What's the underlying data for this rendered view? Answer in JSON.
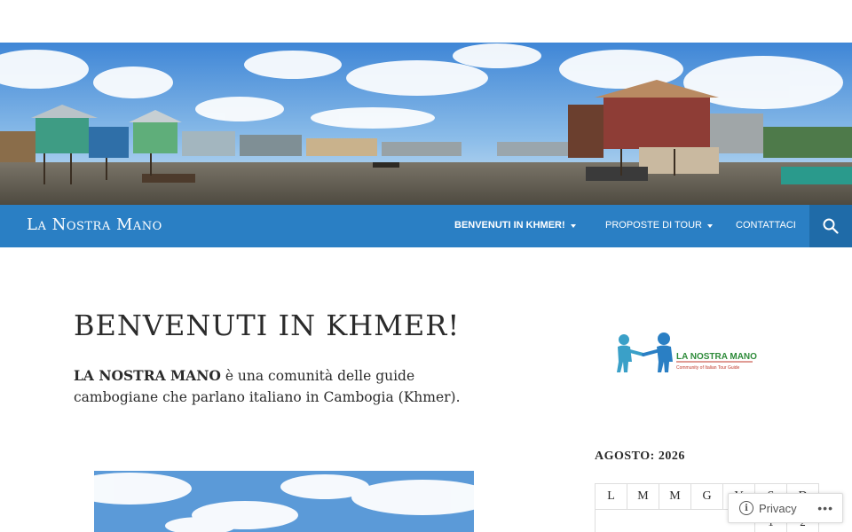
{
  "header": {
    "site_title": "La Nostra Mano",
    "nav": [
      {
        "label": "BENVENUTI IN KHMER!",
        "has_submenu": true,
        "active": true
      },
      {
        "label": "PROPOSTE DI TOUR",
        "has_submenu": true,
        "active": false
      },
      {
        "label": "CONTATTACI",
        "has_submenu": false,
        "active": false
      }
    ],
    "search_icon": "search-icon"
  },
  "banner": {
    "icon": "floating-village-banner"
  },
  "entry": {
    "title": "BENVENUTI IN KHMER!",
    "intro_strong": "LA NOSTRA MANO",
    "intro_rest": " è una comunità delle guide cambogiane che parlano italiano in Cambogia (Khmer)."
  },
  "sidebar": {
    "logo": {
      "brand": "LA NOSTRA MANO",
      "tagline": "Community of Italian Tour Guide"
    },
    "calendar": {
      "caption": "AGOSTO: 2026",
      "weekdays": [
        "L",
        "M",
        "M",
        "G",
        "V",
        "S",
        "D"
      ],
      "first_row": [
        "",
        "",
        "",
        "",
        "",
        "1",
        "2"
      ]
    }
  },
  "privacy": {
    "label": "Privacy"
  },
  "colors": {
    "nav_bg": "#2a7fc4",
    "search_bg": "#1f6ba8",
    "text": "#2b2b2b",
    "logo_green": "#2e8b3a",
    "logo_blue": "#3aa0c8"
  }
}
